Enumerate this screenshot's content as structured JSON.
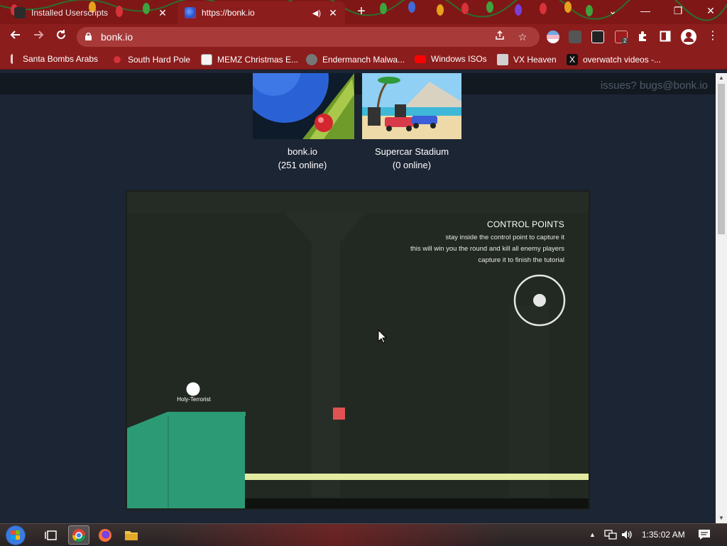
{
  "browser": {
    "tabs": [
      {
        "title": "Installed Userscripts",
        "close": "✕"
      },
      {
        "title": "https://bonk.io",
        "close": "✕",
        "audio": "◀)"
      }
    ],
    "new_tab": "+",
    "window_controls": {
      "tab_search": "⌄",
      "minimize": "—",
      "restore": "❐",
      "close": "✕"
    },
    "url": "bonk.io",
    "bookmarks": [
      {
        "label": "Santa Bombs Arabs",
        "icon": "mic-icon"
      },
      {
        "label": "South Hard Pole",
        "icon": "snowflake-icon"
      },
      {
        "label": "MEMZ Christmas E...",
        "icon": "page-icon"
      },
      {
        "label": "Endermanch Malwa...",
        "icon": "raccoon-icon"
      },
      {
        "label": "Windows ISOs",
        "icon": "youtube-icon"
      },
      {
        "label": "VX Heaven",
        "icon": "vx-icon"
      },
      {
        "label": "overwatch videos -...",
        "icon": "x-icon"
      }
    ],
    "extensions": {
      "ublock_badge": "2"
    },
    "colors": {
      "frame": "#7f1717",
      "toolbar": "#8c1d1d",
      "omnibox": "#a83a3a"
    }
  },
  "page": {
    "issues_link": "issues? bugs@bonk.io",
    "games": [
      {
        "name": "bonk.io",
        "online": "(251 online)"
      },
      {
        "name": "Supercar Stadium",
        "online": "(0 online)"
      }
    ],
    "tutorial": {
      "title": "CONTROL POINTS",
      "lines": [
        "stay inside the control point to capture it",
        "this will win you the round and kill all enemy players",
        "capture it to finish the tutorial"
      ],
      "player_name": "Holy-Terrorist"
    },
    "colors": {
      "page_bg": "#1c2533",
      "game_bg": "#222922",
      "platform": "#2d9a76",
      "floor": "#e3eba0",
      "enemy": "#e05252"
    }
  },
  "taskbar": {
    "time": "1:35:02 AM",
    "pinned": [
      "chrome-icon",
      "firefox-icon",
      "explorer-icon"
    ]
  }
}
